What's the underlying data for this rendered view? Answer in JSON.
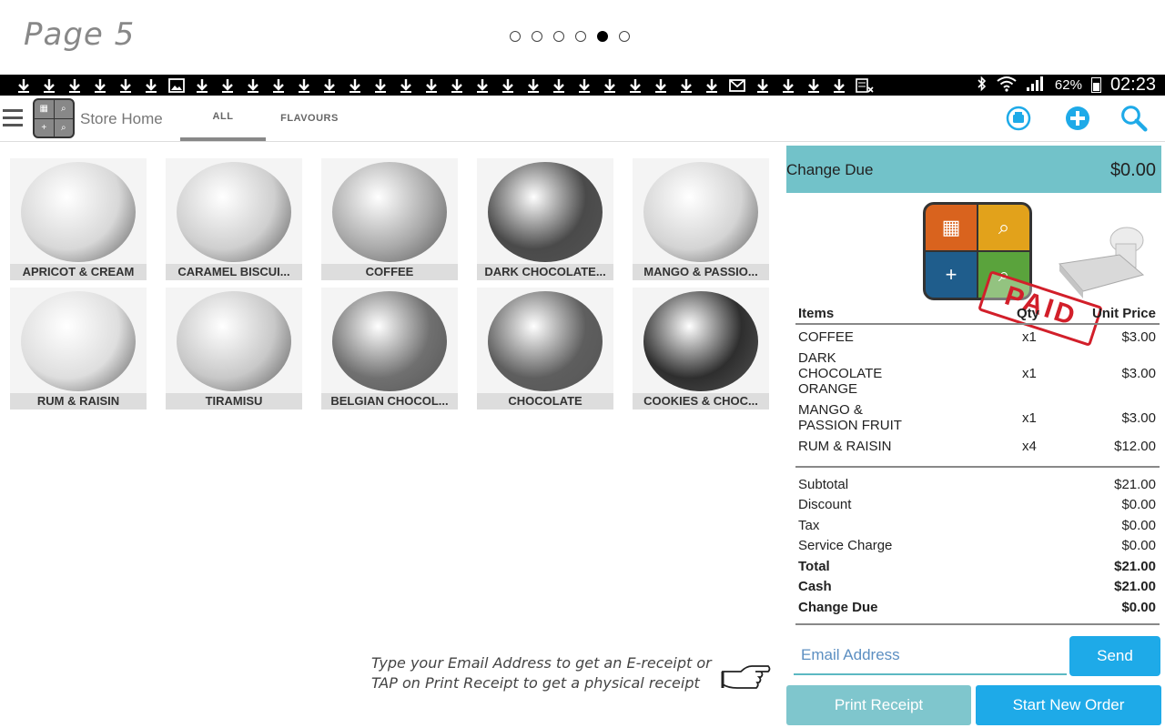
{
  "page": {
    "title": "Page 5",
    "pager": {
      "total": 6,
      "active_index": 4
    }
  },
  "status_bar": {
    "notification_icons": [
      "download-icon",
      "download-icon",
      "download-icon",
      "download-icon",
      "download-icon",
      "download-icon",
      "image-icon",
      "download-icon",
      "download-icon",
      "download-icon",
      "download-icon",
      "download-icon",
      "download-icon",
      "download-icon",
      "download-icon",
      "download-icon",
      "download-icon",
      "download-icon",
      "download-icon",
      "download-icon",
      "download-icon",
      "download-icon",
      "download-icon",
      "download-icon",
      "download-icon",
      "download-icon",
      "download-icon",
      "download-icon",
      "gmail-icon",
      "download-icon",
      "download-icon",
      "download-icon",
      "download-icon",
      "sheet-icon"
    ],
    "battery": "62%",
    "time": "02:23"
  },
  "appbar": {
    "store_label": "Store Home",
    "tabs": [
      {
        "label": "ALL",
        "active": true
      },
      {
        "label": "FLAVOURS",
        "active": false
      }
    ],
    "icons": [
      "register-icon",
      "add-icon",
      "search-icon"
    ]
  },
  "products": [
    {
      "name": "APRICOT & CREAM",
      "tone": "#d8d8d8"
    },
    {
      "name": "CARAMEL BISCUI...",
      "tone": "#cfcfcf"
    },
    {
      "name": "COFFEE",
      "tone": "#a9a9a9"
    },
    {
      "name": "DARK CHOCOLATE...",
      "tone": "#4a4a4a"
    },
    {
      "name": "MANGO & PASSIO...",
      "tone": "#d4d4d4"
    },
    {
      "name": "RUM & RAISIN",
      "tone": "#dedede"
    },
    {
      "name": "TIRAMISU",
      "tone": "#c8c8c8"
    },
    {
      "name": "BELGIAN CHOCOL...",
      "tone": "#707070"
    },
    {
      "name": "CHOCOLATE",
      "tone": "#5e5e5e"
    },
    {
      "name": "COOKIES & CHOC...",
      "tone": "#2e2e2e"
    }
  ],
  "change_due_bar": {
    "label": "Change Due",
    "value": "$0.00"
  },
  "stamp": {
    "text": "PAID"
  },
  "receipt": {
    "headers": {
      "item": "Items",
      "qty": "Qty",
      "price": "Unit Price"
    },
    "rows": [
      {
        "item": "COFFEE",
        "qty": "x1",
        "price": "$3.00",
        "lines": 1
      },
      {
        "item": "DARK CHOCOLATE ORANGE",
        "qty": "x1",
        "price": "$3.00",
        "lines": 3
      },
      {
        "item": "MANGO & PASSION FRUIT",
        "qty": "x1",
        "price": "$3.00",
        "lines": 2
      },
      {
        "item": "RUM & RAISIN",
        "qty": "x4",
        "price": "$12.00",
        "lines": 1
      }
    ],
    "summary": [
      {
        "label": "Subtotal",
        "value": "$21.00",
        "bold": false
      },
      {
        "label": "Discount",
        "value": "$0.00",
        "bold": false
      },
      {
        "label": "Tax",
        "value": "$0.00",
        "bold": false
      },
      {
        "label": "Service Charge",
        "value": "$0.00",
        "bold": false
      },
      {
        "label": "Total",
        "value": "$21.00",
        "bold": true
      },
      {
        "label": "Cash",
        "value": "$21.00",
        "bold": true
      },
      {
        "label": "Change Due",
        "value": "$0.00",
        "bold": true
      }
    ]
  },
  "email": {
    "placeholder": "Email Address",
    "value": ""
  },
  "buttons": {
    "send": "Send",
    "print": "Print Receipt",
    "new_order": "Start New Order"
  },
  "hint": {
    "line1": "Type your Email Address to get an E-receipt or",
    "line2": "TAP on Print Receipt to get a physical receipt"
  },
  "colors": {
    "accent": "#1eaae8",
    "teal": "#72c2c9",
    "stamp": "#d21f2a"
  }
}
